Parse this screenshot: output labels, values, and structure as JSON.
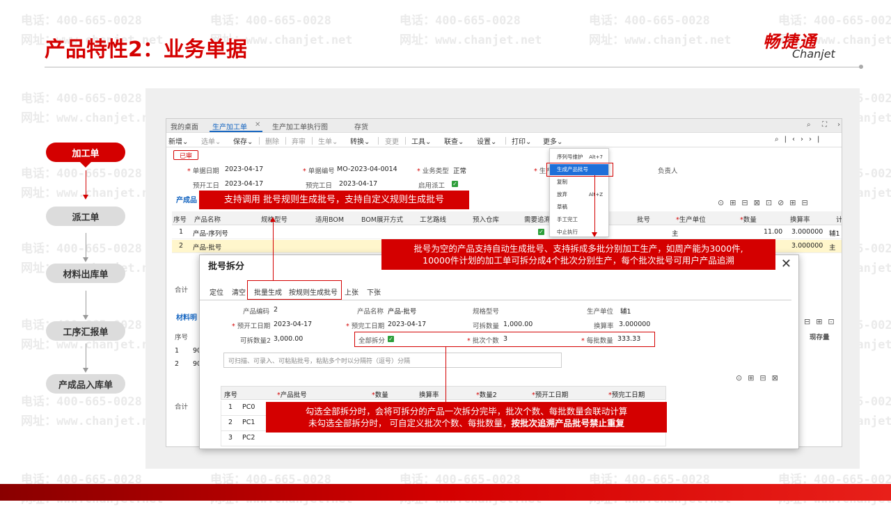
{
  "slide": {
    "title": "产品特性2：业务单据",
    "logo_cn": "畅捷通",
    "logo_en": "Chanjet"
  },
  "watermark": {
    "phone": "电话：400-665-0028",
    "site": "网址：www.chanjet.net"
  },
  "flow": {
    "steps": [
      "加工单",
      "派工单",
      "材料出库单",
      "工序汇报单",
      "产成品入库单"
    ]
  },
  "app": {
    "tabs": [
      "我的桌面",
      "生产加工单",
      "生产加工单执行图",
      "存货"
    ],
    "toolbar": [
      "新增",
      "选单",
      "保存",
      "删除",
      "弃审",
      "生单",
      "转换",
      "变更",
      "工具",
      "联查",
      "设置",
      "打印",
      "更多"
    ],
    "status": "已审",
    "header": {
      "doc_date_label": "单据日期",
      "doc_date": "2023-04-17",
      "doc_no_label": "单据编号",
      "doc_no": "MO-2023-04-0014",
      "biz_type_label": "业务类型",
      "biz_type": "正常",
      "plan_start_label": "预开工日",
      "plan_start": "2023-04-17",
      "plan_end_label": "预完工日",
      "plan_end": "2023-04-17",
      "dispatch_label": "启用派工",
      "owner_label": "负责人",
      "prod_label": "生产"
    },
    "products_section": "产成品",
    "materials_section": "材料明",
    "grid_columns": [
      "序号",
      "产品名称",
      "规格型号",
      "适用BOM",
      "BOM展开方式",
      "工艺路线",
      "预入仓库",
      "需要追溯",
      "批号",
      "生产单位",
      "数量",
      "换算率",
      "计"
    ],
    "grid_rows": [
      {
        "no": "1",
        "name": "产品-序列号",
        "unit": "主",
        "qty": "11.00",
        "rate": "3.000000",
        "aux": "辅1"
      },
      {
        "no": "2",
        "name": "产品-批号",
        "unit": "",
        "qty": "",
        "rate": "3.000000",
        "aux": "主"
      }
    ],
    "total_label": "合计",
    "mat_rows": [
      "90",
      "90"
    ],
    "stock_col": "现存量"
  },
  "context_menu": {
    "items": [
      {
        "label": "序列号维护",
        "shortcut": "Alt+7"
      },
      {
        "label": "生成产品批号",
        "shortcut": ""
      },
      {
        "label": "复制",
        "shortcut": ""
      },
      {
        "label": "放弃",
        "shortcut": "Alt+Z"
      },
      {
        "label": "草稿",
        "shortcut": ""
      },
      {
        "label": "手工完工",
        "shortcut": ""
      },
      {
        "label": "中止执行",
        "shortcut": ""
      }
    ]
  },
  "dialog": {
    "title": "批号拆分",
    "toolbar": [
      "定位",
      "清空",
      "批量生成",
      "按规则生成批号",
      "上张",
      "下张"
    ],
    "fields": {
      "prod_code_label": "产品编码",
      "prod_code": "2",
      "prod_name_label": "产品名称",
      "prod_name": "产品-批号",
      "spec_label": "规格型号",
      "spec": "",
      "unit_label": "生产单位",
      "unit": "辅1",
      "start_label": "预开工日期",
      "start": "2023-04-17",
      "end_label": "预完工日期",
      "end": "2023-04-17",
      "splittable_label": "可拆数量",
      "splittable": "1,000.00",
      "rate_label": "换算率",
      "rate": "3.000000",
      "splittable2_label": "可拆数量2",
      "splittable2": "3,000.00",
      "split_all_label": "全部拆分",
      "batch_count_label": "批次个数",
      "batch_count": "3",
      "batch_qty_label": "每批数量",
      "batch_qty": "333.33"
    },
    "paste_placeholder": "可扫描、可录入、可粘贴批号，粘贴多个时以分隔符（逗号）分隔",
    "table_columns": [
      "序号",
      "产品批号",
      "数量",
      "换算率",
      "数量2",
      "预开工日期",
      "预完工日期"
    ],
    "table_rows": [
      {
        "no": "1",
        "batch": "PC0"
      },
      {
        "no": "2",
        "batch": "PC1"
      },
      {
        "no": "3",
        "batch": "PC2"
      }
    ]
  },
  "callouts": {
    "rule": "支持调用 批号规则生成批号，支持自定义规则生成批号",
    "auto_line1": "批号为空的产品支持自动生成批号、支持拆成多批分别加工生产，如周产能为3000件,",
    "auto_line2": "10000件计划的加工单可拆分成4个批次分别生产，每个批次批号可用户产品追溯",
    "split_line1": "勾选全部拆分时，会将可拆分的产品一次拆分完毕，批次个数、每批数量会联动计算",
    "split_line2a": "未勾选全部拆分时， 可自定义批次个数、每批数量，",
    "split_line2b": "按批次追溯产品批号禁止重复"
  }
}
